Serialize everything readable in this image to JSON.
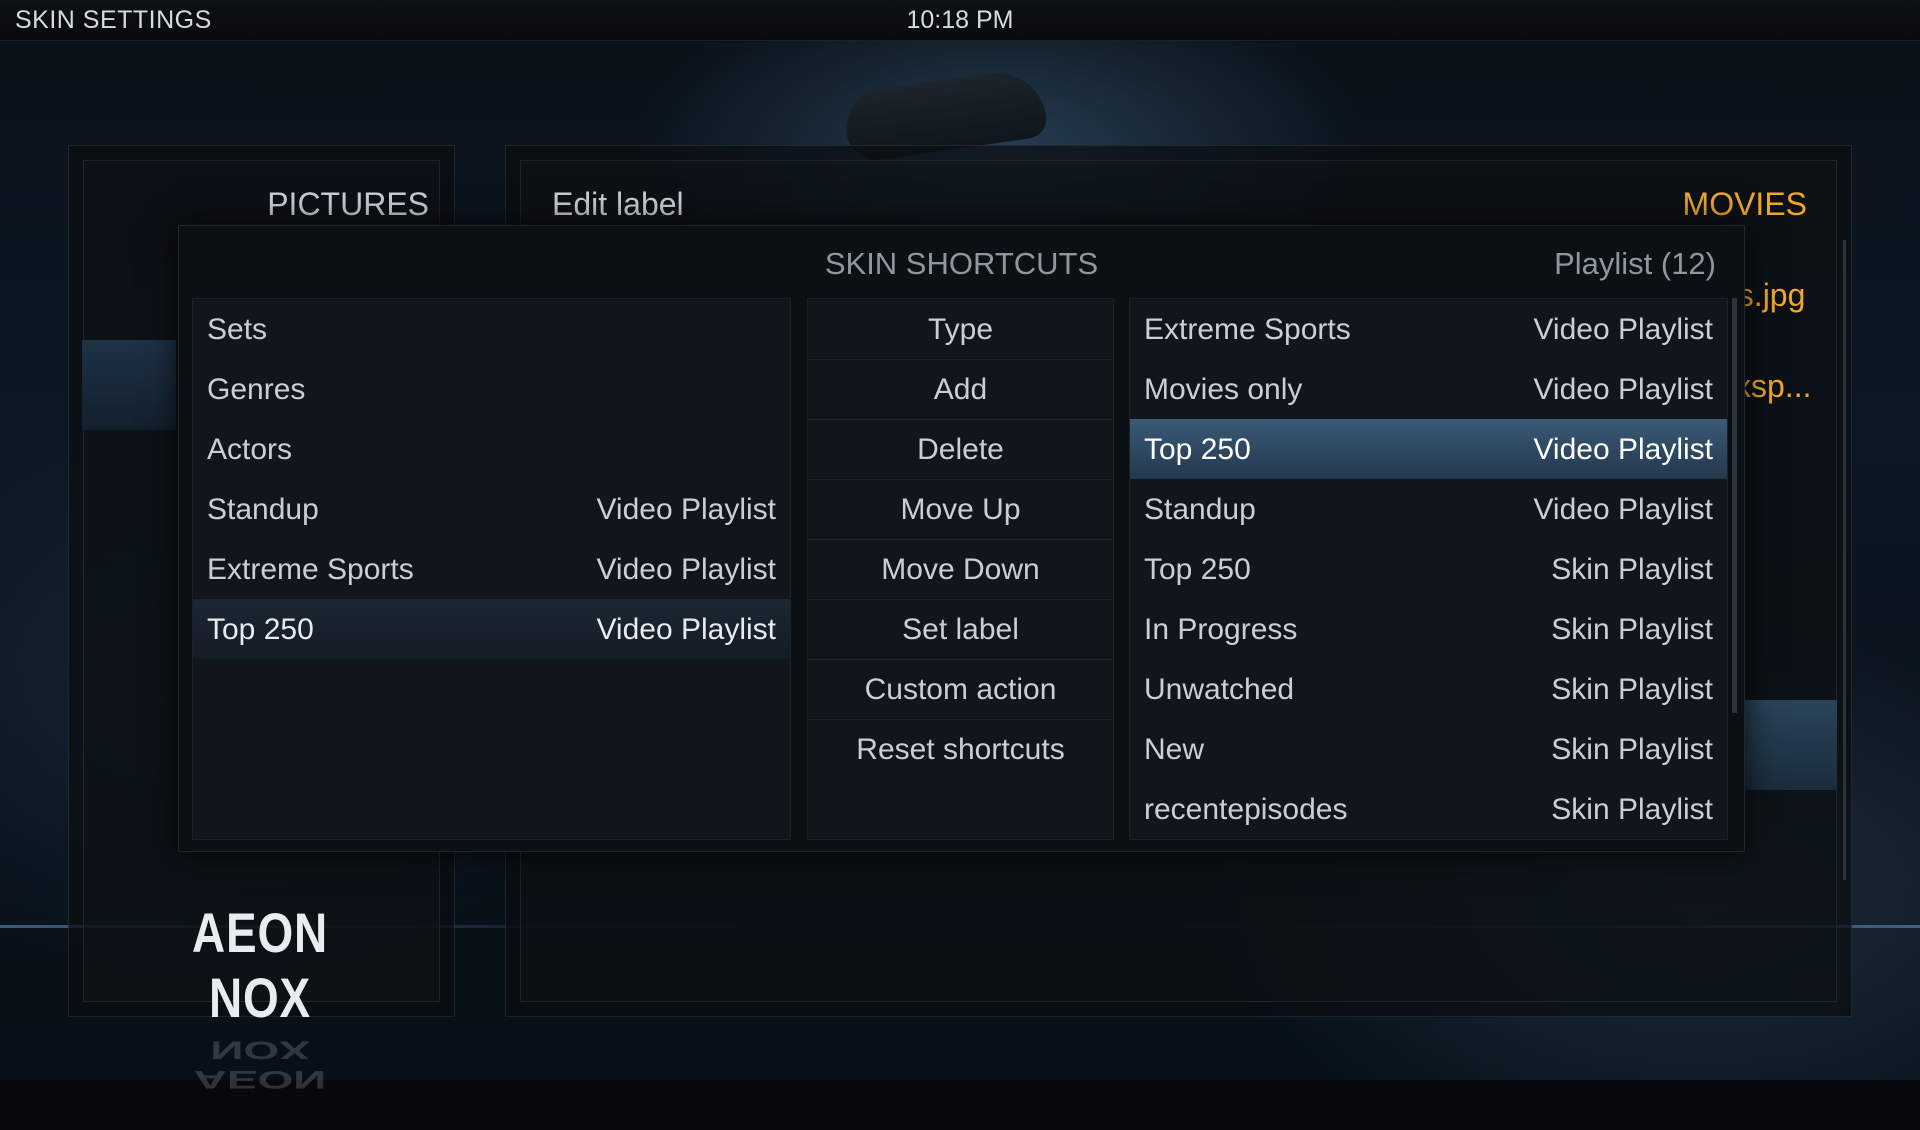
{
  "topbar": {
    "title": "SKIN SETTINGS",
    "clock": "10:18 PM"
  },
  "left_panel": {
    "heading": "PICTURES",
    "logo": "AEON NOX"
  },
  "right_panel": {
    "edit_label": "Edit label",
    "category": "MOVIES",
    "peek_item_1": "es.jpg",
    "peek_item_2": "xsp..."
  },
  "dialog": {
    "title": "SKIN SHORTCUTS",
    "count": "Playlist (12)",
    "current_shortcuts": [
      {
        "label": "Sets",
        "type": ""
      },
      {
        "label": "Genres",
        "type": ""
      },
      {
        "label": "Actors",
        "type": ""
      },
      {
        "label": "Standup",
        "type": "Video Playlist"
      },
      {
        "label": "Extreme Sports",
        "type": "Video Playlist"
      },
      {
        "label": "Top 250",
        "type": "Video Playlist",
        "selected": true
      }
    ],
    "actions": [
      "Type",
      "Add",
      "Delete",
      "Move Up",
      "Move Down",
      "Set label",
      "Custom action",
      "Reset shortcuts"
    ],
    "available": [
      {
        "label": "Extreme Sports",
        "type": "Video Playlist"
      },
      {
        "label": "Movies only",
        "type": "Video Playlist"
      },
      {
        "label": "Top 250",
        "type": "Video Playlist",
        "focused": true
      },
      {
        "label": "Standup",
        "type": "Video Playlist"
      },
      {
        "label": "Top 250",
        "type": "Skin Playlist"
      },
      {
        "label": "In Progress",
        "type": "Skin Playlist"
      },
      {
        "label": "Unwatched",
        "type": "Skin Playlist"
      },
      {
        "label": "New",
        "type": "Skin Playlist"
      },
      {
        "label": "recentepisodes",
        "type": "Skin Playlist"
      }
    ]
  },
  "colors": {
    "accent": "#f0a62c",
    "focus": "#3a5a76",
    "text": "#c8d0d6"
  }
}
